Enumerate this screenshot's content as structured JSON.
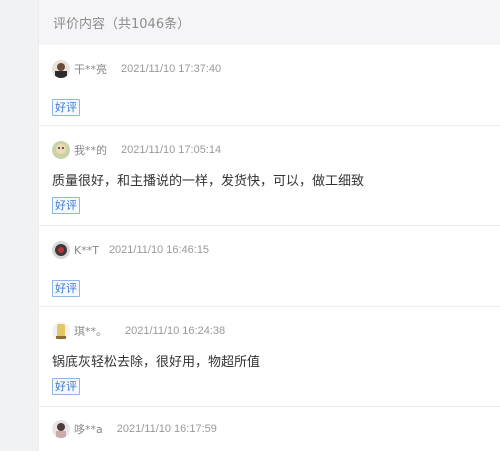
{
  "header": {
    "title": "评价内容（共1046条）"
  },
  "reviews": [
    {
      "nickname": "干**亮",
      "time": "2021/11/10 17:37:40",
      "text": "",
      "tag": "好评",
      "avatar_icon": "user-avatar-photo"
    },
    {
      "nickname": "我**的",
      "time": "2021/11/10 17:05:14",
      "text": "质量很好，和主播说的一样，发货快，可以，做工细致",
      "tag": "好评",
      "avatar_icon": "user-avatar-photo"
    },
    {
      "nickname": "K**T",
      "time": "2021/11/10 16:46:15",
      "text": "",
      "tag": "好评",
      "avatar_icon": "user-avatar-photo"
    },
    {
      "nickname": "琪**。",
      "time": "2021/11/10 16:24:38",
      "text": "锅底灰轻松去除，很好用，物超所值",
      "tag": "好评",
      "avatar_icon": "user-avatar-photo"
    },
    {
      "nickname": "哆**a",
      "time": "2021/11/10 16:17:59",
      "text": "",
      "tag": "",
      "avatar_icon": "user-avatar-photo"
    }
  ],
  "colors": {
    "tag_border": "#8fb4e6",
    "tag_text": "#3a78c9",
    "header_bg": "#f5f5f7"
  }
}
